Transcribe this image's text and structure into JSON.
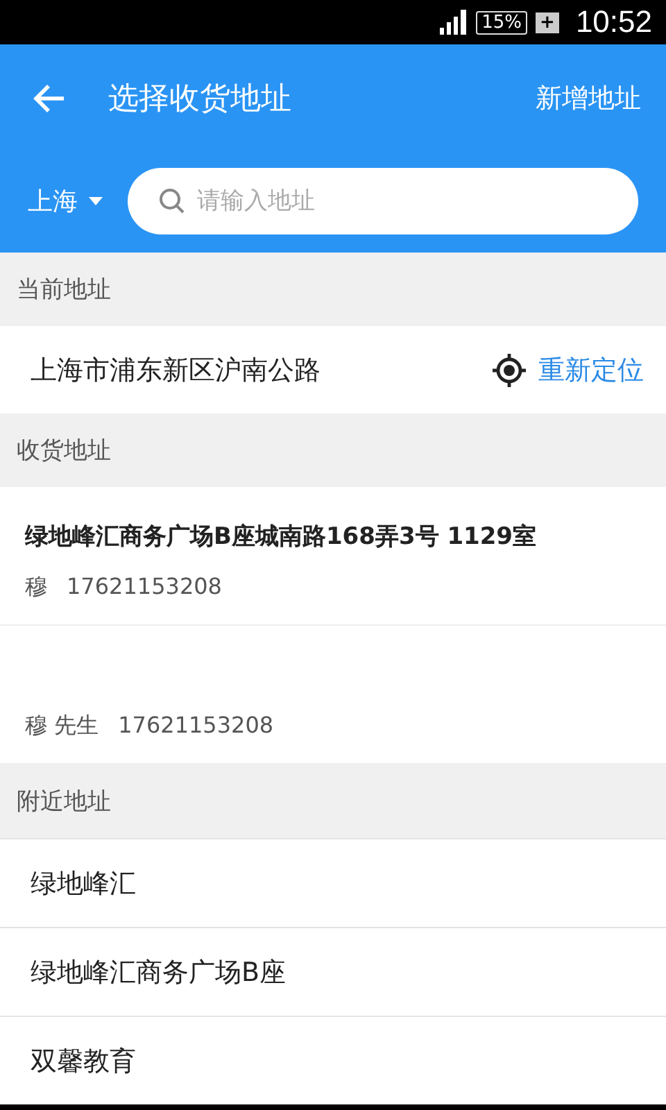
{
  "status_bar": {
    "battery": "15%",
    "charging_mark": "+",
    "time": "10:52"
  },
  "header": {
    "title": "选择收货地址",
    "action": "新增地址"
  },
  "search": {
    "city": "上海",
    "placeholder": "请输入地址"
  },
  "current_section": {
    "heading": "当前地址",
    "address": "上海市浦东新区沪南公路",
    "relocate": "重新定位"
  },
  "address_section": {
    "heading": "收货地址",
    "items": [
      {
        "address": "绿地峰汇商务广场B座城南路168弄3号 1129室",
        "contact": "穆",
        "phone": "17621153208"
      },
      {
        "contact": "穆 先生",
        "phone": "17621153208"
      }
    ]
  },
  "nearby_section": {
    "heading": "附近地址",
    "items": [
      "绿地峰汇",
      "绿地峰汇商务广场B座",
      "双馨教育"
    ]
  }
}
